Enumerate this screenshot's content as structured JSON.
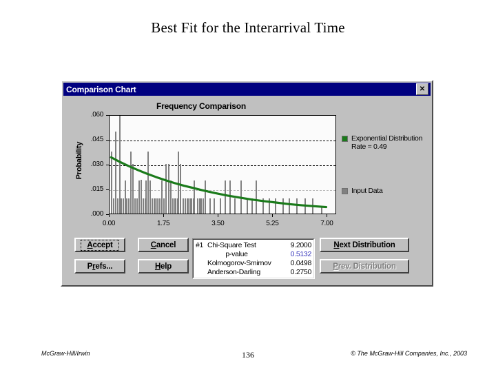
{
  "slide": {
    "title": "Best Fit for the Interarrival Time"
  },
  "dialog": {
    "titlebar": "Comparison Chart",
    "close_icon": "✕"
  },
  "chart_data": {
    "type": "bar",
    "title": "Frequency Comparison",
    "xlabel": "",
    "ylabel": "Probability",
    "xlim": [
      0.0,
      7.3
    ],
    "ylim": [
      0.0,
      0.06
    ],
    "xticks": [
      "0.00",
      "1.75",
      "3.50",
      "5.25",
      "7.00"
    ],
    "xtick_values": [
      0.0,
      1.75,
      3.5,
      5.25,
      7.0
    ],
    "yticks": [
      ".000",
      ".015",
      ".030",
      ".045",
      ".060"
    ],
    "ytick_values": [
      0.0,
      0.015,
      0.03,
      0.045,
      0.06
    ],
    "gridlines": [
      0.015,
      0.03,
      0.045
    ],
    "grid": true,
    "legend_position": "right",
    "series": [
      {
        "name": "Input Data",
        "type": "bar",
        "color": "#808080",
        "x": [
          0.05,
          0.12,
          0.18,
          0.24,
          0.3,
          0.36,
          0.42,
          0.48,
          0.54,
          0.6,
          0.66,
          0.72,
          0.8,
          0.86,
          0.93,
          1.0,
          1.07,
          1.14,
          1.21,
          1.28,
          1.35,
          1.43,
          1.5,
          1.58,
          1.65,
          1.72,
          1.8,
          1.88,
          1.95,
          2.02,
          2.1,
          2.18,
          2.26,
          2.34,
          2.42,
          2.5,
          2.6,
          2.7,
          2.8,
          2.92,
          3.05,
          3.2,
          3.35,
          3.55,
          3.7,
          3.85,
          4.0,
          4.2,
          4.4,
          4.55,
          4.7,
          4.9,
          5.1,
          5.3,
          5.55,
          5.75,
          6.0,
          6.25,
          6.5,
          6.8
        ],
        "values": [
          0.0375,
          0.009,
          0.0495,
          0.009,
          0.06,
          0.009,
          0.009,
          0.02,
          0.009,
          0.009,
          0.0375,
          0.03,
          0.009,
          0.009,
          0.02,
          0.0205,
          0.009,
          0.02,
          0.0375,
          0.02,
          0.009,
          0.009,
          0.009,
          0.009,
          0.02,
          0.009,
          0.03,
          0.03,
          0.02,
          0.009,
          0.009,
          0.0375,
          0.03,
          0.009,
          0.009,
          0.009,
          0.009,
          0.02,
          0.009,
          0.009,
          0.02,
          0.009,
          0.009,
          0.009,
          0.02,
          0.02,
          0.009,
          0.02,
          0.009,
          0.009,
          0.02,
          0.009,
          0.009,
          0.009,
          0.009,
          0.009,
          0.009,
          0.009,
          0.009,
          0.0045
        ]
      },
      {
        "name": "Exponential Distribution",
        "type": "line",
        "color": "#1a7a1a",
        "formula_note": "Rate = 0.49",
        "x": [
          0.05,
          0.3,
          0.6,
          0.9,
          1.2,
          1.5,
          1.8,
          2.1,
          2.4,
          2.7,
          3.0,
          3.4,
          3.8,
          4.2,
          4.6,
          5.0,
          5.4,
          5.8,
          6.2,
          6.6,
          7.0
        ],
        "values": [
          0.0345,
          0.032,
          0.0293,
          0.0268,
          0.0245,
          0.0224,
          0.0205,
          0.0187,
          0.0171,
          0.0157,
          0.0143,
          0.0126,
          0.0111,
          0.0098,
          0.0086,
          0.0076,
          0.0067,
          0.0058,
          0.0051,
          0.0045,
          0.004
        ]
      }
    ]
  },
  "legend": {
    "entries": [
      {
        "label": "Exponential Distribution",
        "sublabel": "Rate = 0.49",
        "color": "#1a7a1a",
        "swatch_name": "legend-swatch-exponential"
      },
      {
        "label": "Input Data",
        "sublabel": "",
        "color": "#808080",
        "swatch_name": "legend-swatch-input-data"
      }
    ]
  },
  "buttons": {
    "accept": {
      "label": "Accept",
      "mnemonic": "A",
      "focused": true,
      "enabled": true
    },
    "cancel": {
      "label": "Cancel",
      "mnemonic": "C",
      "focused": false,
      "enabled": true
    },
    "prefs": {
      "label": "Prefs...",
      "mnemonic": "r",
      "focused": false,
      "enabled": true
    },
    "help": {
      "label": "Help",
      "mnemonic": "H",
      "focused": false,
      "enabled": true
    },
    "next_distribution": {
      "label": "Next Distribution",
      "mnemonic": "N",
      "focused": false,
      "enabled": true
    },
    "prev_distribution": {
      "label": "Prev. Distribution",
      "mnemonic": "P",
      "focused": false,
      "enabled": false
    }
  },
  "stats": {
    "index": "#1",
    "rows": [
      {
        "label": "Chi-Square Test",
        "value": "9.2000",
        "indent": false,
        "highlight": false
      },
      {
        "label": "p-value",
        "value": "0.5132",
        "indent": true,
        "highlight": true
      },
      {
        "label": "Kolmogorov-Smirnov",
        "value": "0.0498",
        "indent": false,
        "highlight": false
      },
      {
        "label": "Anderson-Darling",
        "value": "0.2750",
        "indent": false,
        "highlight": false
      }
    ]
  },
  "footer": {
    "left": "McGraw-Hill/Irwin",
    "page": "136",
    "right": "© The McGraw-Hill Companies, Inc., 2003"
  }
}
